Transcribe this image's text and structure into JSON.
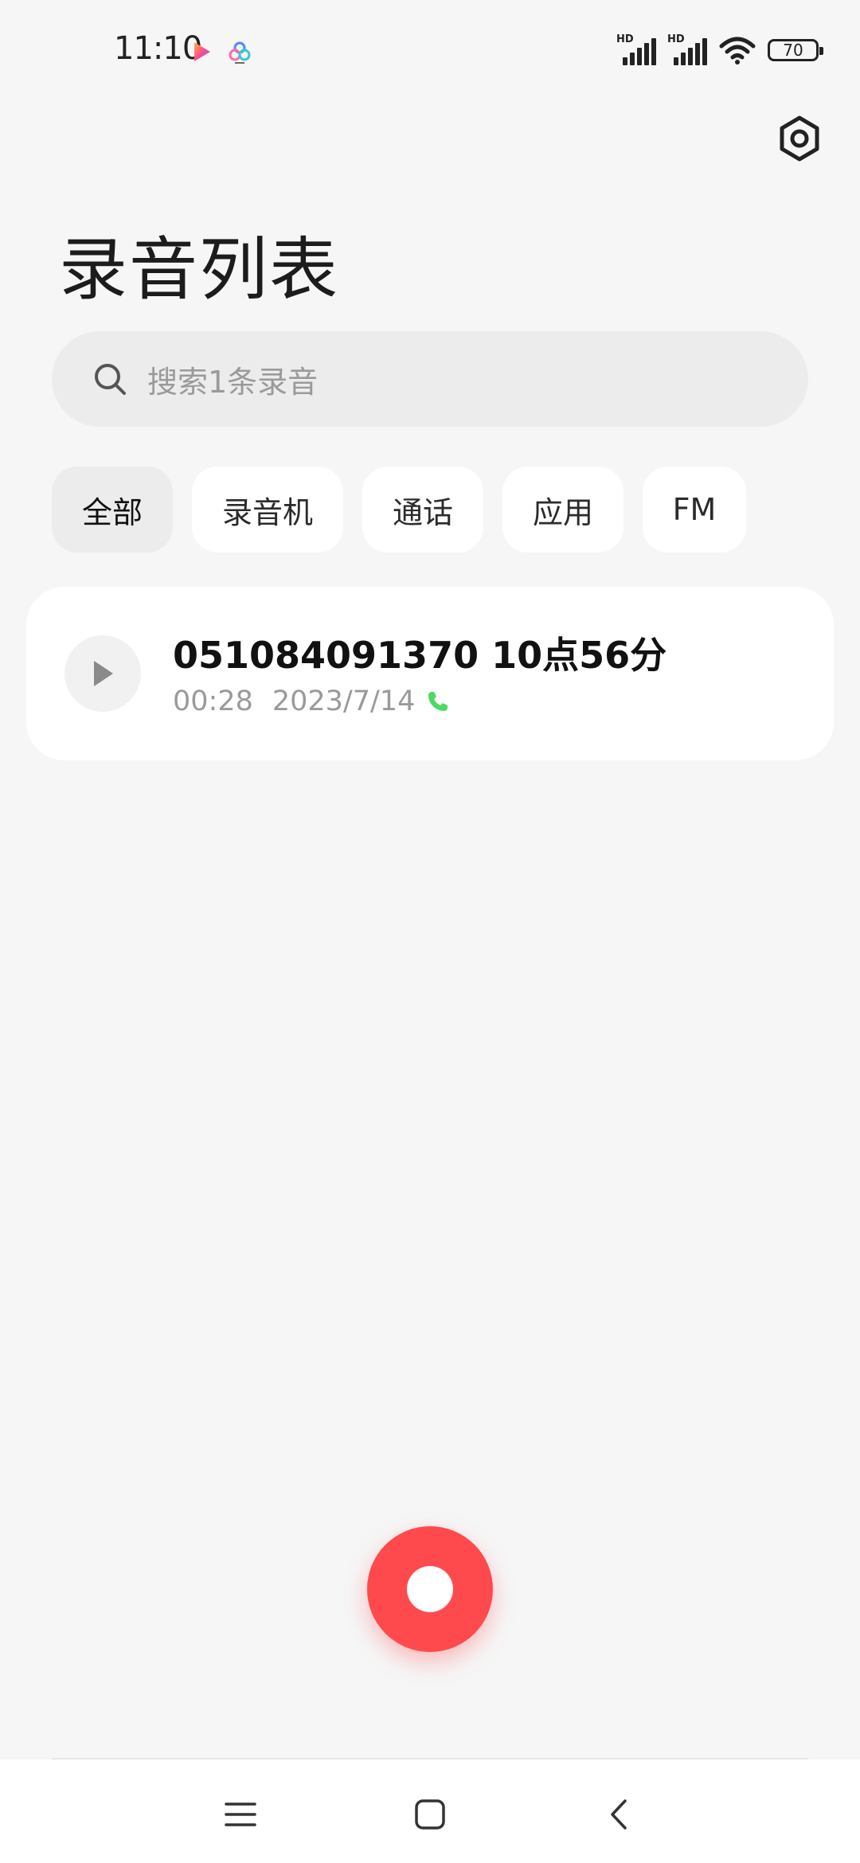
{
  "status_bar": {
    "time": "11:10",
    "battery": "70",
    "signal_1_label": "HD",
    "signal_2_label": "HD",
    "icons": [
      "video-app-icon",
      "cloud-app-icon",
      "signal-icon",
      "signal-icon",
      "wifi-icon",
      "battery-icon"
    ]
  },
  "header": {
    "title": "录音列表",
    "settings_icon": "gear-icon"
  },
  "search": {
    "placeholder": "搜索1条录音"
  },
  "filters": [
    {
      "label": "全部",
      "active": true
    },
    {
      "label": "录音机",
      "active": false
    },
    {
      "label": "通话",
      "active": false
    },
    {
      "label": "应用",
      "active": false
    },
    {
      "label": "FM",
      "active": false
    }
  ],
  "recordings": [
    {
      "title": "051084091370 10点56分",
      "duration": "00:28",
      "date": "2023/7/14",
      "type_icon": "phone-call-icon",
      "accent": "#4cd964"
    }
  ],
  "fab": {
    "icon": "record-icon",
    "color": "#ff4a4d"
  },
  "nav": {
    "icons": [
      "menu-icon",
      "home-icon",
      "back-icon"
    ]
  }
}
